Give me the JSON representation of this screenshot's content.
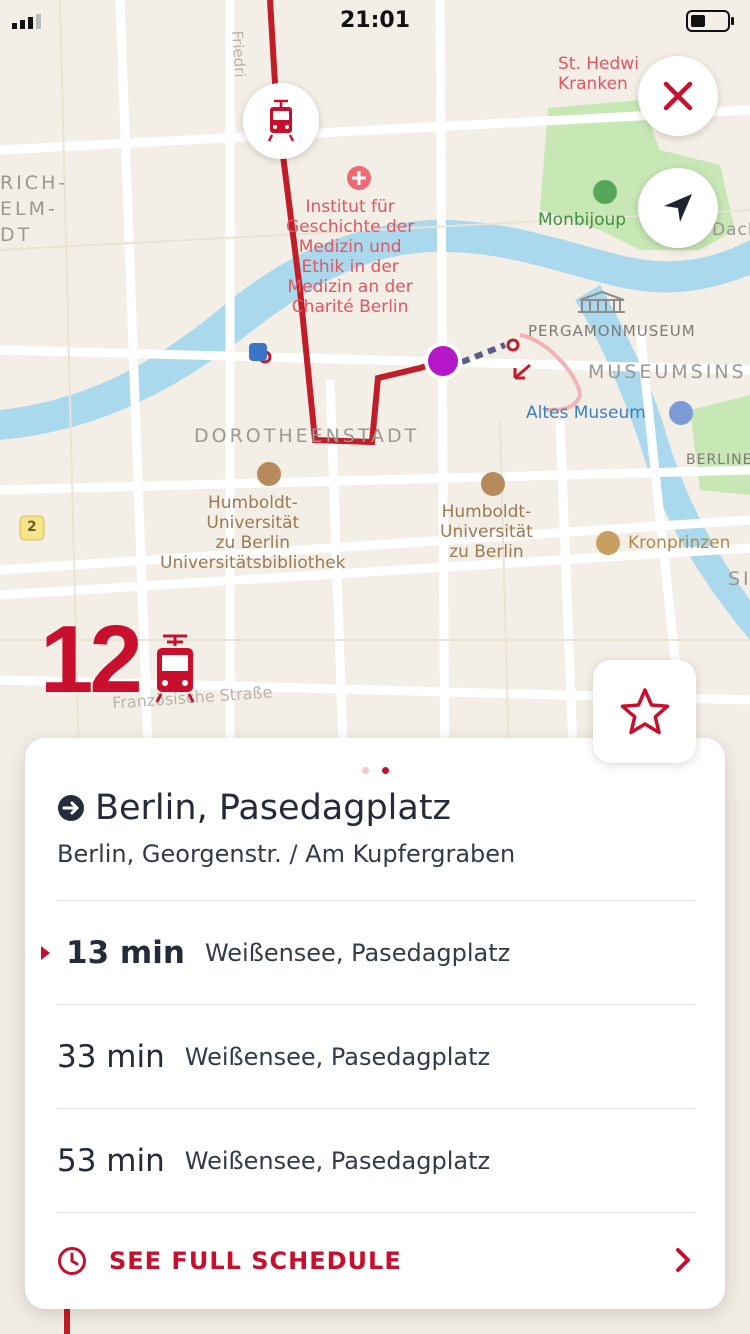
{
  "status_bar": {
    "time": "21:01"
  },
  "map": {
    "labels": {
      "institut": "Institut für\nGeschichte der\nMedizin und\nEthik in der\nMedizin an der\nCharité Berlin",
      "hedwig": "St. Hedwi\nKranken",
      "monbijou": "Monbijoup",
      "pergamon": "PERGAMONMUSEUM",
      "museumsinsel": "MUSEUMSINS",
      "altes": "Altes Museum",
      "berliner": "BERLINE",
      "dorotheenstadt": "DOROTHEENSTADT",
      "hu1": "Humboldt-\nUniversität\nzu Berlin\nUniversitätsbibliothek",
      "hu2": "Humboldt-\nUniversität\nzu Berlin",
      "kronprinzen": "Kronprinzen",
      "friedrich": "RICH-\nELM-\nDT",
      "friedrichstr": "Friedri",
      "franzoesische": "Französische Straße",
      "road_number": "2",
      "dach": "Dach",
      "si": "SI"
    }
  },
  "line": {
    "number": "12"
  },
  "card": {
    "destination": "Berlin, Pasedagplatz",
    "stop": "Berlin, Georgenstr. / Am Kupfergraben",
    "departures": [
      {
        "time": "13 min",
        "destination": "Weißensee, Pasedagplatz"
      },
      {
        "time": "33 min",
        "destination": "Weißensee, Pasedagplatz"
      },
      {
        "time": "53 min",
        "destination": "Weißensee, Pasedagplatz"
      }
    ],
    "schedule_label": "SEE FULL SCHEDULE"
  },
  "colors": {
    "accent": "#c8102e",
    "current_stop": "#b518c9",
    "water": "#a8d8ef",
    "park": "#b8e0a4"
  }
}
